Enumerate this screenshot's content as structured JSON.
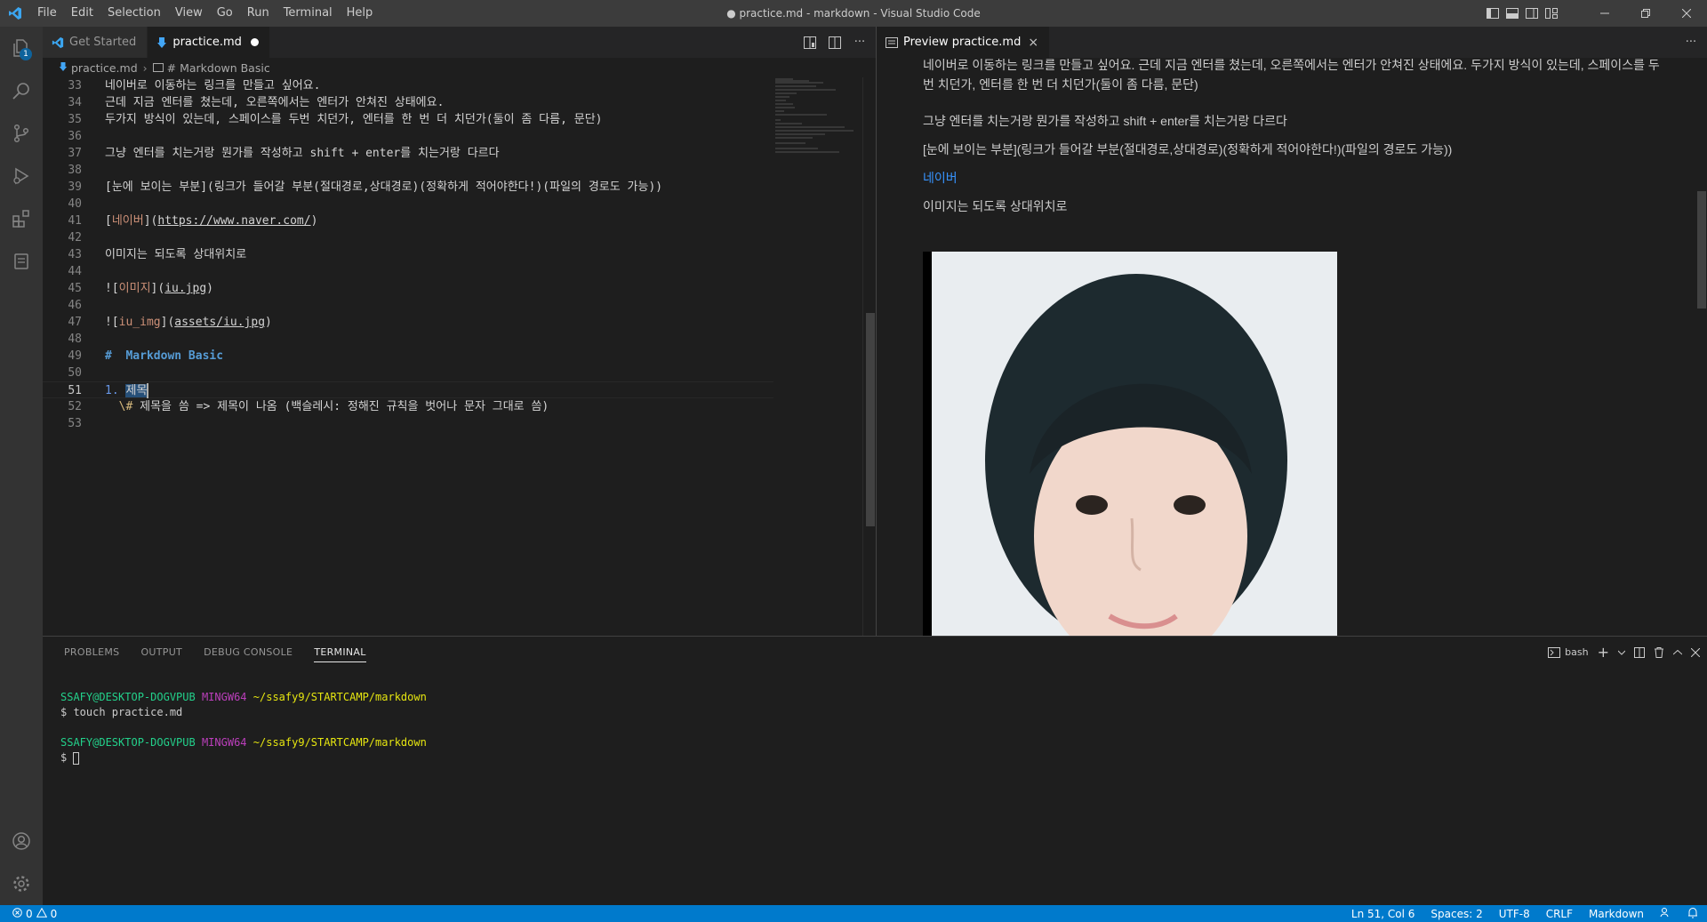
{
  "window": {
    "title": "● practice.md - markdown - Visual Studio Code",
    "menu": [
      "File",
      "Edit",
      "Selection",
      "View",
      "Go",
      "Run",
      "Terminal",
      "Help"
    ]
  },
  "activity": {
    "explorer_badge": "1"
  },
  "editor": {
    "tabs": [
      {
        "label": "Get Started",
        "active": false
      },
      {
        "label": "practice.md",
        "active": true,
        "dirty": true
      }
    ],
    "breadcrumb": [
      "practice.md",
      "# Markdown Basic"
    ],
    "lines": [
      {
        "n": "33",
        "text": "네이버로 이동하는 링크를 만들고 싶어요."
      },
      {
        "n": "34",
        "text": "근데 지금 엔터를 쳤는데, 오른쪽에서는 엔터가 안쳐진 상태에요."
      },
      {
        "n": "35",
        "text": "두가지 방식이 있는데, 스페이스를 두번 치던가, 엔터를 한 번 더 치던가(둘이 좀 다름, 문단)"
      },
      {
        "n": "36",
        "text": ""
      },
      {
        "n": "37",
        "text": "그냥 엔터를 치는거랑 뭔가를 작성하고 shift + enter를 치는거랑 다르다"
      },
      {
        "n": "38",
        "text": ""
      },
      {
        "n": "39",
        "text": "[눈에 보이는 부분](링크가 들어갈 부분(절대경로,상대경로)(정확하게 적어야한다!)(파일의 경로도 가능))"
      },
      {
        "n": "40",
        "text": ""
      },
      {
        "n": "41",
        "pre": "[",
        "link": "네이버",
        "mid": "](",
        "url": "https://www.naver.com/",
        "post": ")"
      },
      {
        "n": "42",
        "text": ""
      },
      {
        "n": "43",
        "text": "이미지는 되도록 상대위치로"
      },
      {
        "n": "44",
        "text": ""
      },
      {
        "n": "45",
        "pre": "![",
        "link": "이미지",
        "mid": "](",
        "url": "iu.jpg",
        "post": ")"
      },
      {
        "n": "46",
        "text": ""
      },
      {
        "n": "47",
        "pre": "![",
        "link": "iu_img",
        "mid": "](",
        "url": "assets/iu.jpg",
        "post": ")"
      },
      {
        "n": "48",
        "text": ""
      },
      {
        "n": "49",
        "heading": "#  Markdown Basic"
      },
      {
        "n": "50",
        "text": ""
      },
      {
        "n": "51",
        "num": "1.",
        "sel": "제목",
        "current": true
      },
      {
        "n": "52",
        "esc": "\\#",
        "text": " 제목을 씀 => 제목이 나옴 (백슬레시: 정해진 규칙을 벗어나 문자 그대로 씀)"
      },
      {
        "n": "53",
        "text": ""
      }
    ]
  },
  "preview": {
    "tab": "Preview practice.md",
    "paragraphs": [
      "네이버로 이동하는 링크를 만들고 싶어요. 근데 지금 엔터를 쳤는데, 오른쪽에서는 엔터가 안쳐진 상태에요. 두가지 방식이 있는데, 스페이스를 두번 치던가, 엔터를 한 번 더 치던가(둘이 좀 다름, 문단)",
      "그냥 엔터를 치는거랑 뭔가를 작성하고 shift + enter를 치는거랑 다르다",
      "[눈에 보이는 부분](링크가 들어갈 부분(절대경로,상대경로)(정확하게 적어야한다!)(파일의 경로도 가능))"
    ],
    "link": "네이버",
    "image_caption": "이미지는 되도록 상대위치로"
  },
  "panel": {
    "tabs": [
      "PROBLEMS",
      "OUTPUT",
      "DEBUG CONSOLE",
      "TERMINAL"
    ],
    "active_tab": "TERMINAL",
    "shell": "bash",
    "terminal": {
      "user": "SSAFY@DESKTOP-DOGVPUB",
      "host": "MINGW64",
      "path": "~/ssafy9/STARTCAMP/markdown",
      "command": "$ touch practice.md",
      "prompt": "$ "
    }
  },
  "status": {
    "errors": "0",
    "warnings": "0",
    "position": "Ln 51, Col 6",
    "spaces": "Spaces: 2",
    "encoding": "UTF-8",
    "eol": "CRLF",
    "language": "Markdown"
  },
  "colors": {
    "accent": "#007acc",
    "link": "#3794ff",
    "terminal_user": "#23d18b",
    "terminal_host": "#bc3fbc",
    "terminal_path": "#e5e510"
  }
}
